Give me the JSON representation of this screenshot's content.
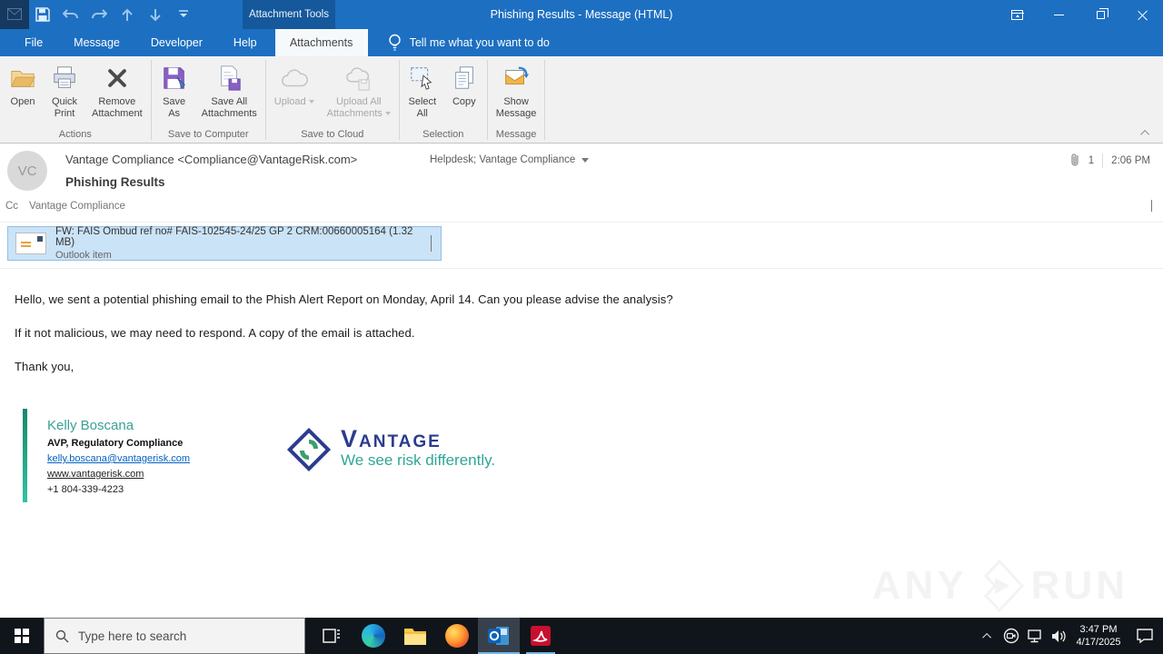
{
  "titlebar": {
    "title": "Phishing Results  -  Message (HTML)",
    "contextual_header": "Attachment Tools"
  },
  "tabs": {
    "file": "File",
    "message": "Message",
    "developer": "Developer",
    "help": "Help",
    "attachments": "Attachments",
    "tell_me": "Tell me what you want to do"
  },
  "ribbon": {
    "buttons": {
      "open": "Open",
      "quick_print": "Quick\nPrint",
      "remove_attachment": "Remove\nAttachment",
      "save_as": "Save\nAs",
      "save_all": "Save All\nAttachments",
      "upload": "Upload",
      "upload_all": "Upload All\nAttachments",
      "select_all": "Select\nAll",
      "copy": "Copy",
      "show_message": "Show\nMessage"
    },
    "groups": {
      "actions": "Actions",
      "save_to_computer": "Save to Computer",
      "save_to_cloud": "Save to Cloud",
      "selection": "Selection",
      "message": "Message"
    }
  },
  "header": {
    "avatar_initials": "VC",
    "sender": "Vantage Compliance <Compliance@VantageRisk.com>",
    "recipients": "Helpdesk; Vantage Compliance",
    "subject": "Phishing Results",
    "attachment_count": "1",
    "time": "2:06 PM",
    "cc_label": "Cc",
    "cc_value": "Vantage Compliance"
  },
  "attachment": {
    "name": "FW: FAIS Ombud ref no# FAIS-102545-24/25 GP 2 CRM:00660005164 (1.32 MB)",
    "kind": "Outlook item"
  },
  "body": {
    "p1": "Hello, we sent a potential phishing email to the Phish Alert Report on Monday, April 14. Can you please advise the analysis?",
    "p2": "If it not malicious, we may need to respond. A copy of the email is attached.",
    "p3": "Thank you,"
  },
  "signature": {
    "name": "Kelly Boscana",
    "title": "AVP, Regulatory Compliance",
    "email": "kelly.boscana@vantagerisk.com",
    "website": "www.vantagerisk.com",
    "phone": "+1 804-339-4223",
    "brand_wordmark": "Vantage",
    "brand_tagline": "We see risk differently."
  },
  "watermark": {
    "left": "ANY",
    "right": "RUN"
  },
  "taskbar": {
    "search_placeholder": "Type here to search",
    "time": "3:47 PM",
    "date": "4/17/2025"
  },
  "colors": {
    "titlebar_blue": "#1d6fc1",
    "contextual_blue": "#15589c",
    "attachment_selected": "#cbe3f7",
    "signature_teal": "#2aa796",
    "brand_navy": "#2b3c8f",
    "link_blue": "#0563c1",
    "taskbar_dark": "#10151b"
  }
}
